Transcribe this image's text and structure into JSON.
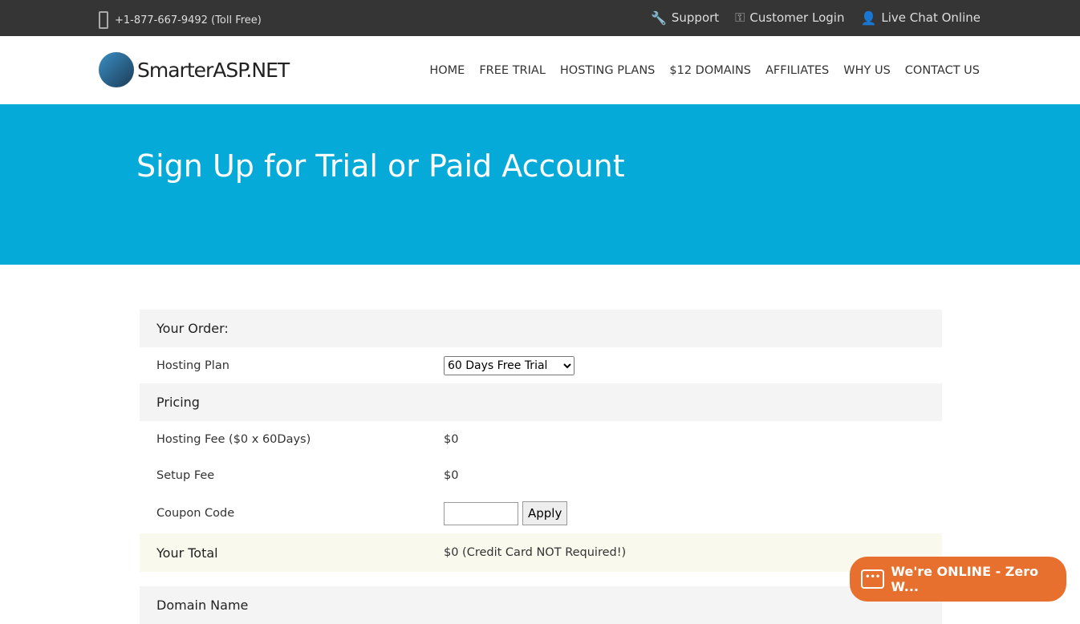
{
  "topbar": {
    "phone": "+1-877-667-9492 (Toll Free)",
    "support": "Support",
    "login": "Customer Login",
    "chat": "Live Chat Online"
  },
  "logo": "SmarterASP.NET",
  "nav": [
    "HOME",
    "FREE TRIAL",
    "HOSTING PLANS",
    "$12 DOMAINS",
    "AFFILIATES",
    "WHY US",
    "CONTACT US"
  ],
  "banner": {
    "title": "Sign Up for Trial or Paid Account"
  },
  "order": {
    "heading": "Your Order:",
    "plan_label": "Hosting Plan",
    "plan_value": "60 Days Free Trial",
    "pricing": "Pricing",
    "fee_label": "Hosting Fee ($0 x 60Days)",
    "fee_value": "$0",
    "setup_label": "Setup Fee",
    "setup_value": "$0",
    "coupon_label": "Coupon Code",
    "coupon_value": "",
    "apply": "Apply",
    "total_label": "Your Total",
    "total_value": "$0 (Credit Card NOT Required!)",
    "domain_heading": "Domain Name"
  },
  "chat_widget": {
    "label": "We're ONLINE - Zero W...",
    "color": "#e8702f"
  }
}
